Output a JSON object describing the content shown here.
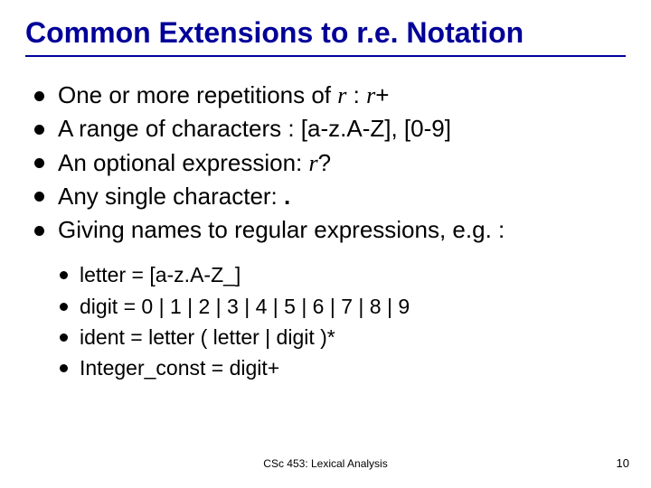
{
  "title": "Common Extensions to r.e. Notation",
  "bullets": [
    {
      "parts": [
        {
          "t": "One or more repetitions of "
        },
        {
          "t": "r",
          "it": true
        },
        {
          "t": " : "
        },
        {
          "t": "r",
          "it": true
        },
        {
          "t": "+"
        }
      ]
    },
    {
      "parts": [
        {
          "t": "A range of characters : [a-z.A-Z], [0-9]"
        }
      ]
    },
    {
      "parts": [
        {
          "t": "An optional expression: "
        },
        {
          "t": "r",
          "it": true
        },
        {
          "t": "?"
        }
      ]
    },
    {
      "parts": [
        {
          "t": "Any single character: "
        },
        {
          "t": ".",
          "bold": true
        }
      ]
    },
    {
      "parts": [
        {
          "t": "Giving names to regular expressions, e.g. :"
        }
      ]
    }
  ],
  "sub_bullets": [
    "letter = [a-z.A-Z_]",
    "digit = 0 | 1 | 2 | 3 | 4 | 5 | 6 | 7 | 8 | 9",
    "ident = letter ( letter | digit )*",
    "Integer_const = digit+"
  ],
  "footer_center": "CSc 453: Lexical Analysis",
  "footer_right": "10"
}
